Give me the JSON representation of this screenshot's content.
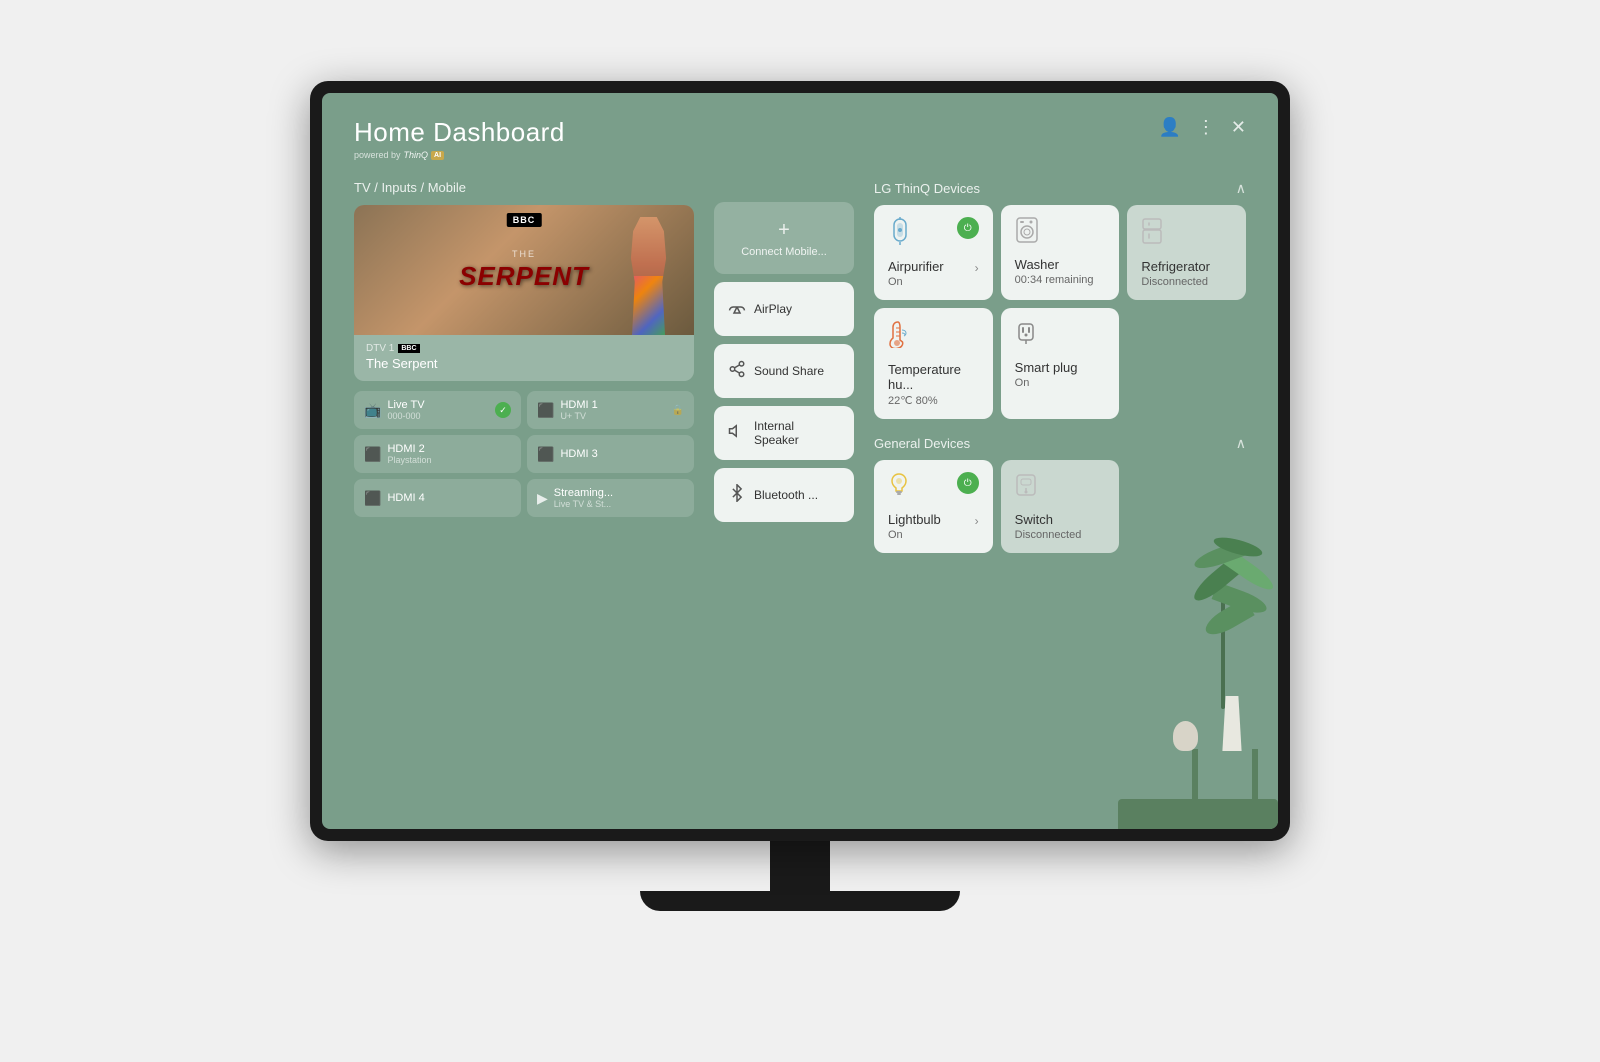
{
  "header": {
    "title": "Home Dashboard",
    "powered_by": "powered by",
    "thinq": "ThinQ",
    "ai_badge": "AI"
  },
  "tv_section": {
    "title": "TV / Inputs / Mobile",
    "channel": "DTV 1",
    "show_name": "The Serpent",
    "bbc": "BBC",
    "show_display": "THE\nSERPENT"
  },
  "inputs": [
    {
      "name": "Live TV",
      "sub": "000-000",
      "icon": "📺",
      "badge": "check"
    },
    {
      "name": "HDMI 1",
      "sub": "U+ TV",
      "icon": "🔌",
      "badge": "lock"
    },
    {
      "name": "HDMI 2",
      "sub": "Playstation",
      "icon": "🔌",
      "badge": ""
    },
    {
      "name": "HDMI 3",
      "sub": "",
      "icon": "🔌",
      "badge": ""
    },
    {
      "name": "HDMI 4",
      "sub": "",
      "icon": "🔌",
      "badge": ""
    },
    {
      "name": "Streaming...",
      "sub": "Live TV & St...",
      "icon": "▶",
      "badge": ""
    }
  ],
  "connect_mobile": {
    "label": "Connect Mobile..."
  },
  "audio_options": [
    {
      "label": "AirPlay",
      "icon": "airplay"
    },
    {
      "label": "Sound Share",
      "icon": "sound-share"
    },
    {
      "label": "Internal Speaker",
      "icon": "speaker"
    },
    {
      "label": "Bluetooth ...",
      "icon": "bluetooth"
    }
  ],
  "lg_thinq": {
    "title": "LG ThinQ Devices",
    "devices": [
      {
        "name": "Airpurifier",
        "status": "On",
        "icon": "🌀",
        "power": "on",
        "has_arrow": true
      },
      {
        "name": "Washer",
        "status": "00:34 remaining",
        "icon": "🫧",
        "power": "off",
        "has_arrow": false
      },
      {
        "name": "Refrigerator",
        "status": "Disconnected",
        "icon": "🧊",
        "power": "off",
        "has_arrow": false
      },
      {
        "name": "Temperature hu...",
        "status": "22℃ 80%",
        "icon": "🌡",
        "power": "off",
        "has_arrow": false
      },
      {
        "name": "Smart plug",
        "status": "On",
        "icon": "🔌",
        "power": "off",
        "has_arrow": false
      }
    ]
  },
  "general_devices": {
    "title": "General Devices",
    "devices": [
      {
        "name": "Lightbulb",
        "status": "On",
        "icon": "💡",
        "power": "on",
        "has_arrow": true
      },
      {
        "name": "Switch",
        "status": "Disconnected",
        "icon": "🔲",
        "power": "off",
        "has_arrow": false
      }
    ]
  },
  "icons": {
    "user": "👤",
    "more": "⋮",
    "close": "✕",
    "chevron_up": "^",
    "chevron_right": "›"
  },
  "colors": {
    "bg": "#7a9e8a",
    "card_bg": "rgba(255,255,255,0.88)",
    "text_primary": "#ffffff",
    "text_dark": "#333333",
    "green_on": "#4CAF50"
  }
}
